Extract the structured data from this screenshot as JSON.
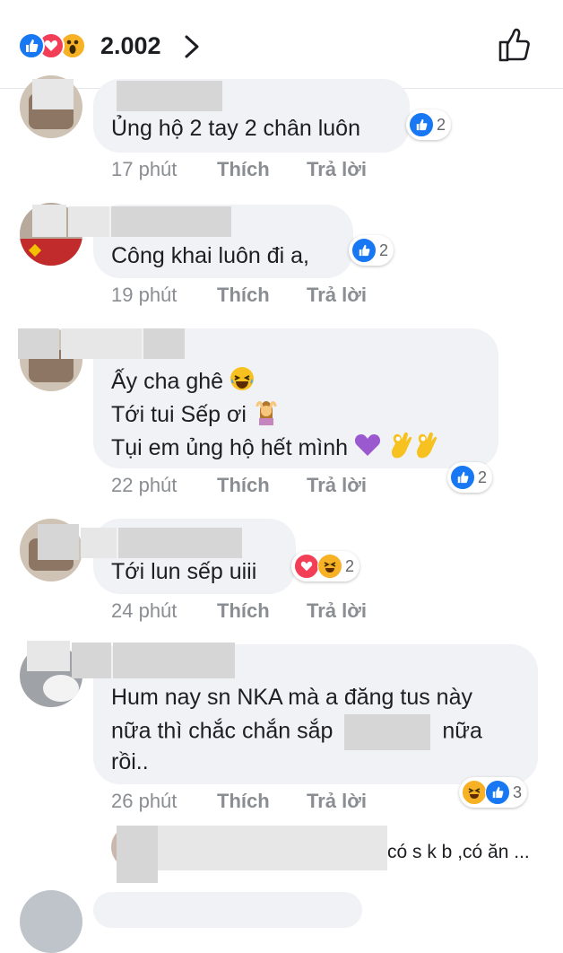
{
  "header": {
    "reaction_count": "2.002"
  },
  "comments": [
    {
      "text": [
        "Ủng hộ 2 tay 2 chân luôn"
      ],
      "time": "17 phút",
      "like": "Thích",
      "reply": "Trả lời",
      "reaction_count": "2",
      "reactions": [
        "like"
      ]
    },
    {
      "text": [
        "Công khai luôn đi a,"
      ],
      "time": "19 phút",
      "like": "Thích",
      "reply": "Trả lời",
      "reaction_count": "2",
      "reactions": [
        "like"
      ]
    },
    {
      "text": [
        "Ấy cha ghê",
        "Tới tui Sếp ơi",
        "Tụi em ủng hộ hết mình"
      ],
      "time": "22 phút",
      "like": "Thích",
      "reply": "Trả lời",
      "reaction_count": "2",
      "reactions": [
        "like"
      ]
    },
    {
      "text": [
        "Tới lun sếp uiii"
      ],
      "time": "24 phút",
      "like": "Thích",
      "reply": "Trả lời",
      "reaction_count": "2",
      "reactions": [
        "love",
        "haha"
      ]
    },
    {
      "text": [
        "Hum nay sn NKA mà a đăng tus này",
        "nữa thì chắc chắn sắp",
        "nữa",
        "rồi.."
      ],
      "time": "26 phút",
      "like": "Thích",
      "reply": "Trả lời",
      "reaction_count": "3",
      "reactions": [
        "haha",
        "like"
      ]
    }
  ],
  "reply_preview": {
    "text": "có s k b ,có ăn ..."
  },
  "colors": {
    "like": "#1877f2",
    "love": "#f33e58",
    "haha": "#f7b125",
    "bubble": "#f0f2f5",
    "meta": "#8a8d91"
  }
}
